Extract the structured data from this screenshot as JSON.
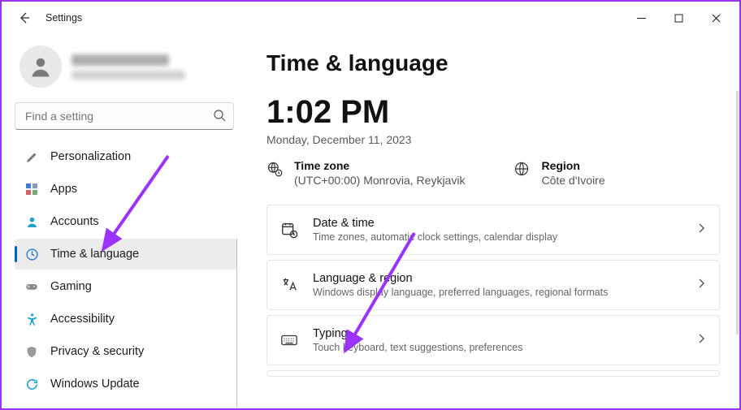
{
  "titlebar": {
    "title": "Settings"
  },
  "sidebar": {
    "search_placeholder": "Find a setting",
    "items": [
      {
        "label": "Personalization"
      },
      {
        "label": "Apps"
      },
      {
        "label": "Accounts"
      },
      {
        "label": "Time & language"
      },
      {
        "label": "Gaming"
      },
      {
        "label": "Accessibility"
      },
      {
        "label": "Privacy & security"
      },
      {
        "label": "Windows Update"
      }
    ]
  },
  "main": {
    "title": "Time & language",
    "clock": "1:02 PM",
    "date": "Monday, December 11, 2023",
    "timezone_label": "Time zone",
    "timezone_value": "(UTC+00:00) Monrovia, Reykjavik",
    "region_label": "Region",
    "region_value": "Côte d'Ivoire",
    "cards": [
      {
        "title": "Date & time",
        "sub": "Time zones, automatic clock settings, calendar display"
      },
      {
        "title": "Language & region",
        "sub": "Windows display language, preferred languages, regional formats"
      },
      {
        "title": "Typing",
        "sub": "Touch keyboard, text suggestions, preferences"
      }
    ]
  }
}
